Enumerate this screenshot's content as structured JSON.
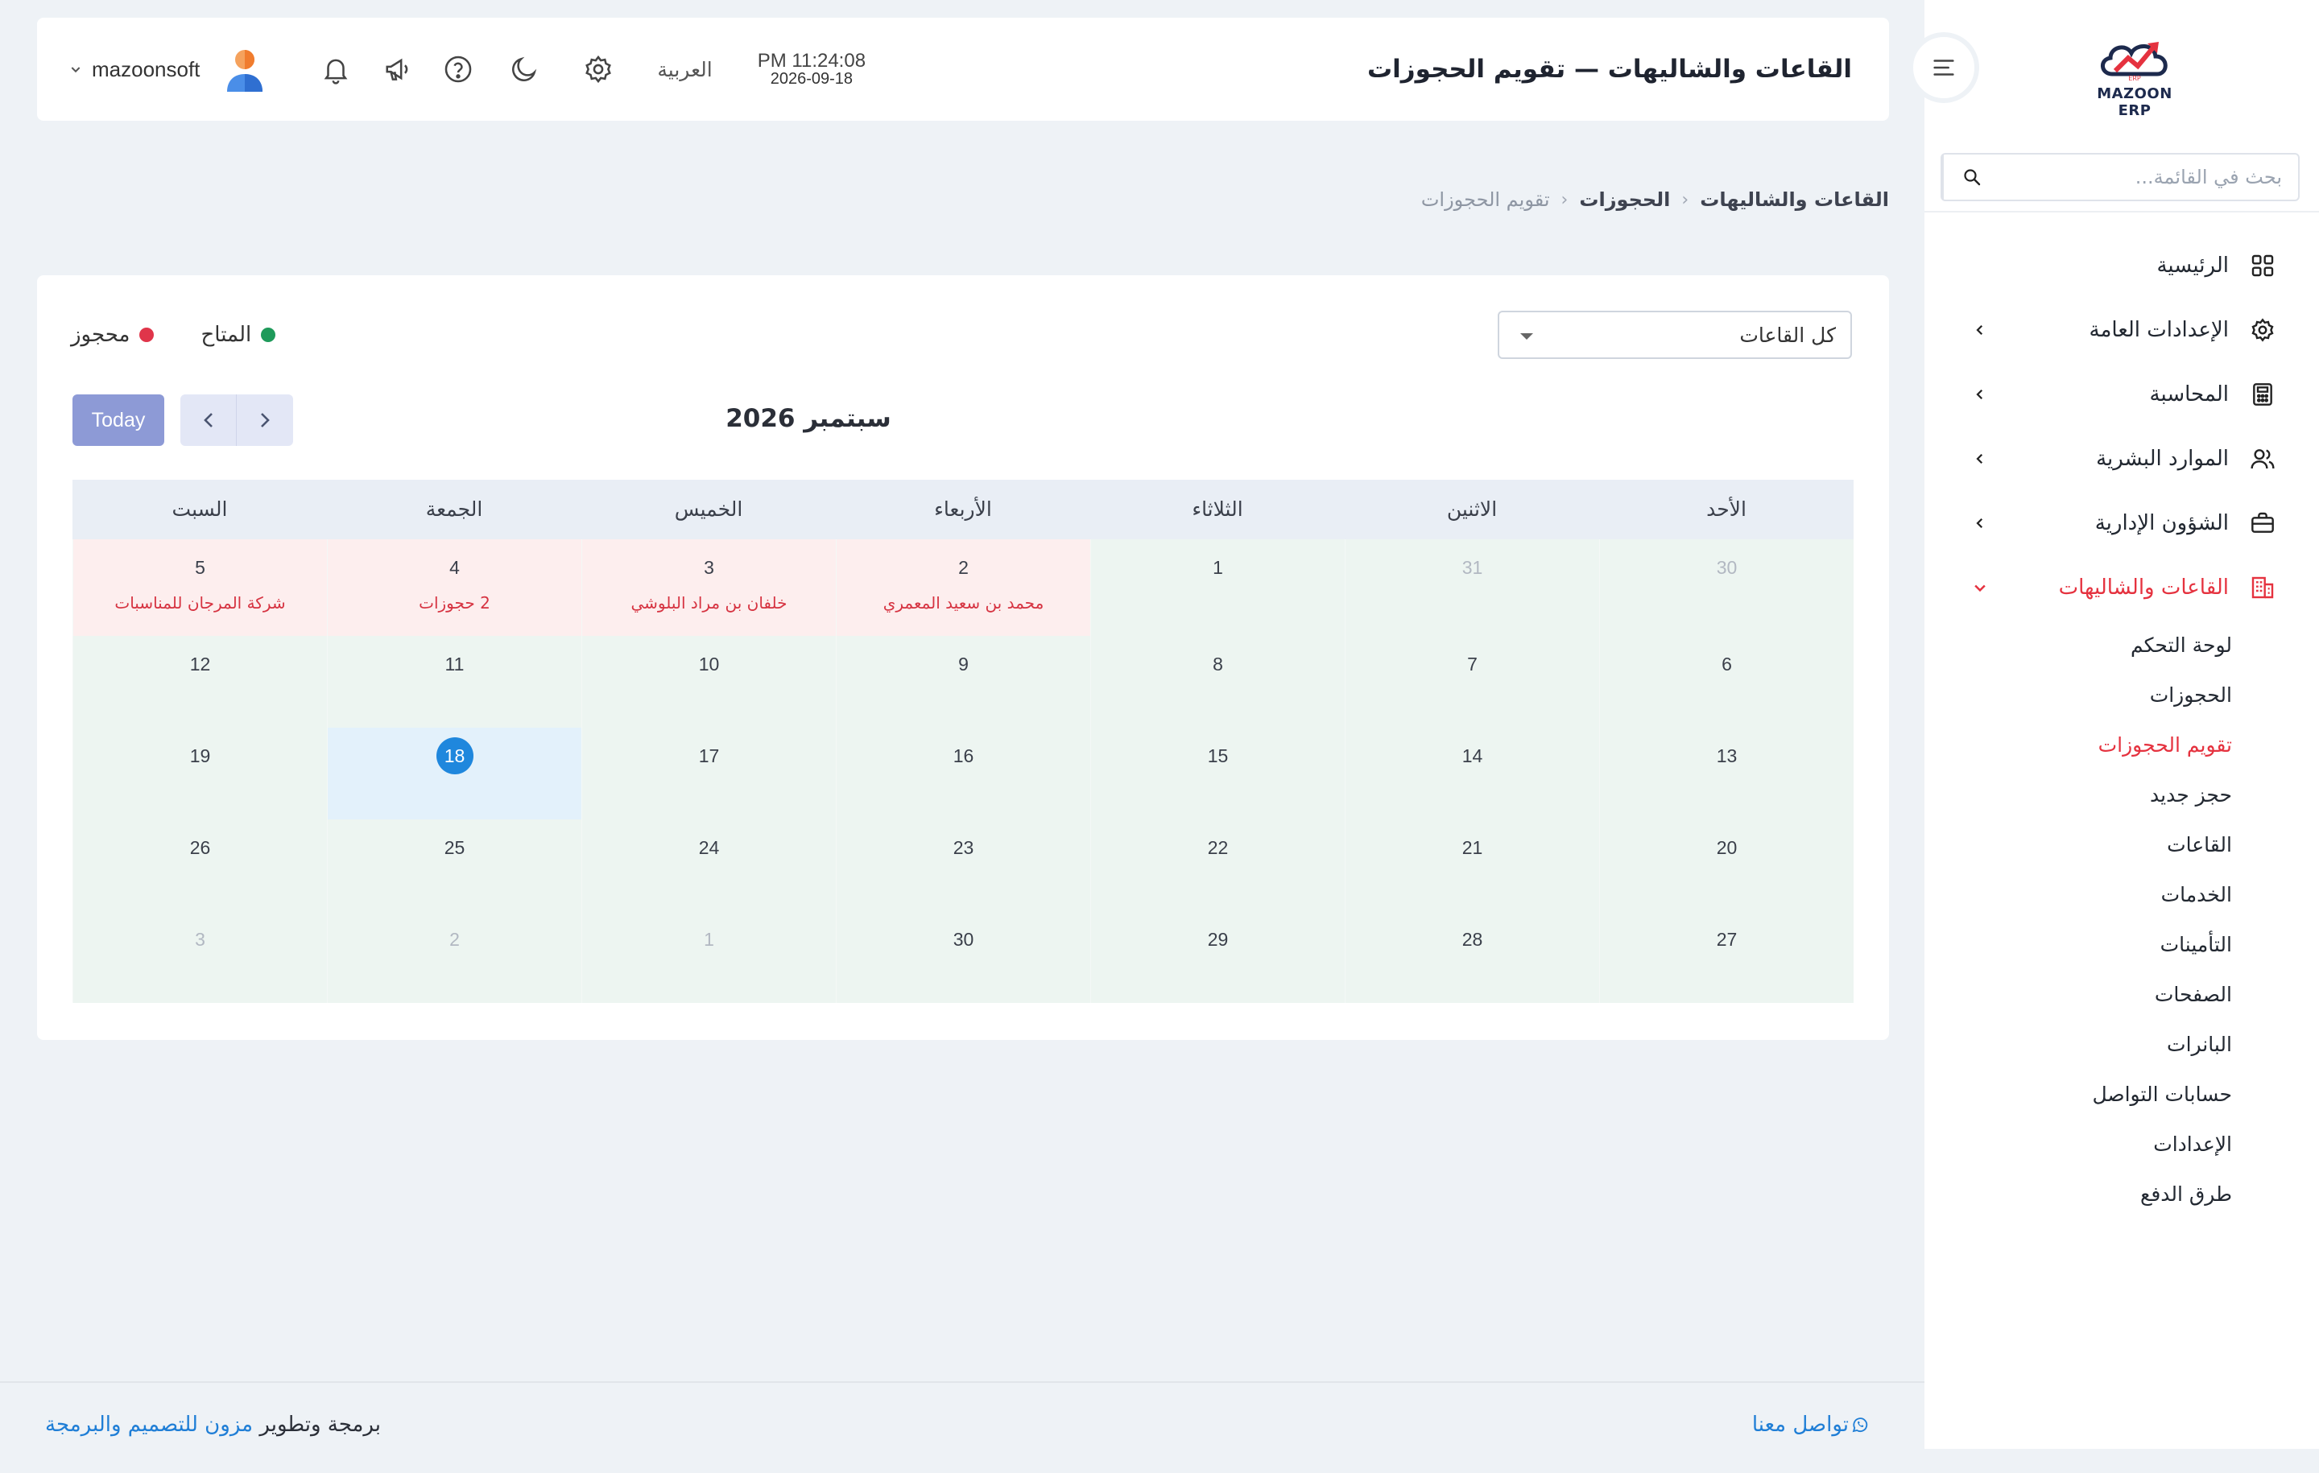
{
  "sidebar": {
    "logo_text": "MAZOON ERP",
    "search_placeholder": "بحث في القائمة...",
    "items": [
      {
        "label": "الرئيسية"
      },
      {
        "label": "الإعدادات العامة"
      },
      {
        "label": "المحاسبة"
      },
      {
        "label": "الموارد البشرية"
      },
      {
        "label": "الشؤون الإدارية"
      },
      {
        "label": "القاعات والشاليهات"
      }
    ],
    "sub_items": [
      "لوحة التحكم",
      "الحجوزات",
      "تقويم الحجوزات",
      "حجز جديد",
      "القاعات",
      "الخدمات",
      "التأمينات",
      "الصفحات",
      "البانرات",
      "حسابات التواصل",
      "الإعدادات",
      "طرق الدفع"
    ],
    "active_color": "#e5323f"
  },
  "header": {
    "title": "القاعات والشاليهات — تقويم الحجوزات",
    "username": "mazoonsoft",
    "language": "العربية",
    "time": "PM 11:24:08",
    "date": "2026-09-18"
  },
  "breadcrumb": {
    "b1": "القاعات والشاليهات",
    "b2": "الحجوزات",
    "b3": "تقويم الحجوزات"
  },
  "calendar": {
    "hall_filter": "كل القاعات",
    "legend_available": "المتاح",
    "legend_booked": "محجوز",
    "available_color": "#1e9a5a",
    "booked_color": "#e0354a",
    "month_title": "سبتمبر 2026",
    "today_label": "Today",
    "weekdays": [
      "الأحد",
      "الاثنين",
      "الثلاثاء",
      "الأربعاء",
      "الخميس",
      "الجمعة",
      "السبت"
    ],
    "weeks": [
      [
        {
          "num": "30",
          "muted": true
        },
        {
          "num": "31",
          "muted": true
        },
        {
          "num": "1"
        },
        {
          "num": "2",
          "booked": true,
          "event": "محمد بن سعيد المعمري"
        },
        {
          "num": "3",
          "booked": true,
          "event": "خلفان بن مراد البلوشي"
        },
        {
          "num": "4",
          "booked": true,
          "event": "2 حجوزات"
        },
        {
          "num": "5",
          "booked": true,
          "event": "شركة المرجان للمناسبات"
        }
      ],
      [
        {
          "num": "6"
        },
        {
          "num": "7"
        },
        {
          "num": "8"
        },
        {
          "num": "9"
        },
        {
          "num": "10"
        },
        {
          "num": "11"
        },
        {
          "num": "12"
        }
      ],
      [
        {
          "num": "13"
        },
        {
          "num": "14"
        },
        {
          "num": "15"
        },
        {
          "num": "16"
        },
        {
          "num": "17"
        },
        {
          "num": "18",
          "today": true
        },
        {
          "num": "19"
        }
      ],
      [
        {
          "num": "20"
        },
        {
          "num": "21"
        },
        {
          "num": "22"
        },
        {
          "num": "23"
        },
        {
          "num": "24"
        },
        {
          "num": "25"
        },
        {
          "num": "26"
        }
      ],
      [
        {
          "num": "27"
        },
        {
          "num": "28"
        },
        {
          "num": "29"
        },
        {
          "num": "30"
        },
        {
          "num": "1",
          "muted": true
        },
        {
          "num": "2",
          "muted": true
        },
        {
          "num": "3",
          "muted": true
        }
      ]
    ]
  },
  "footer": {
    "credit_prefix": "برمجة وتطوير",
    "credit_brand": "مزون للتصميم والبرمجة",
    "contact": "تواصل معنا"
  }
}
